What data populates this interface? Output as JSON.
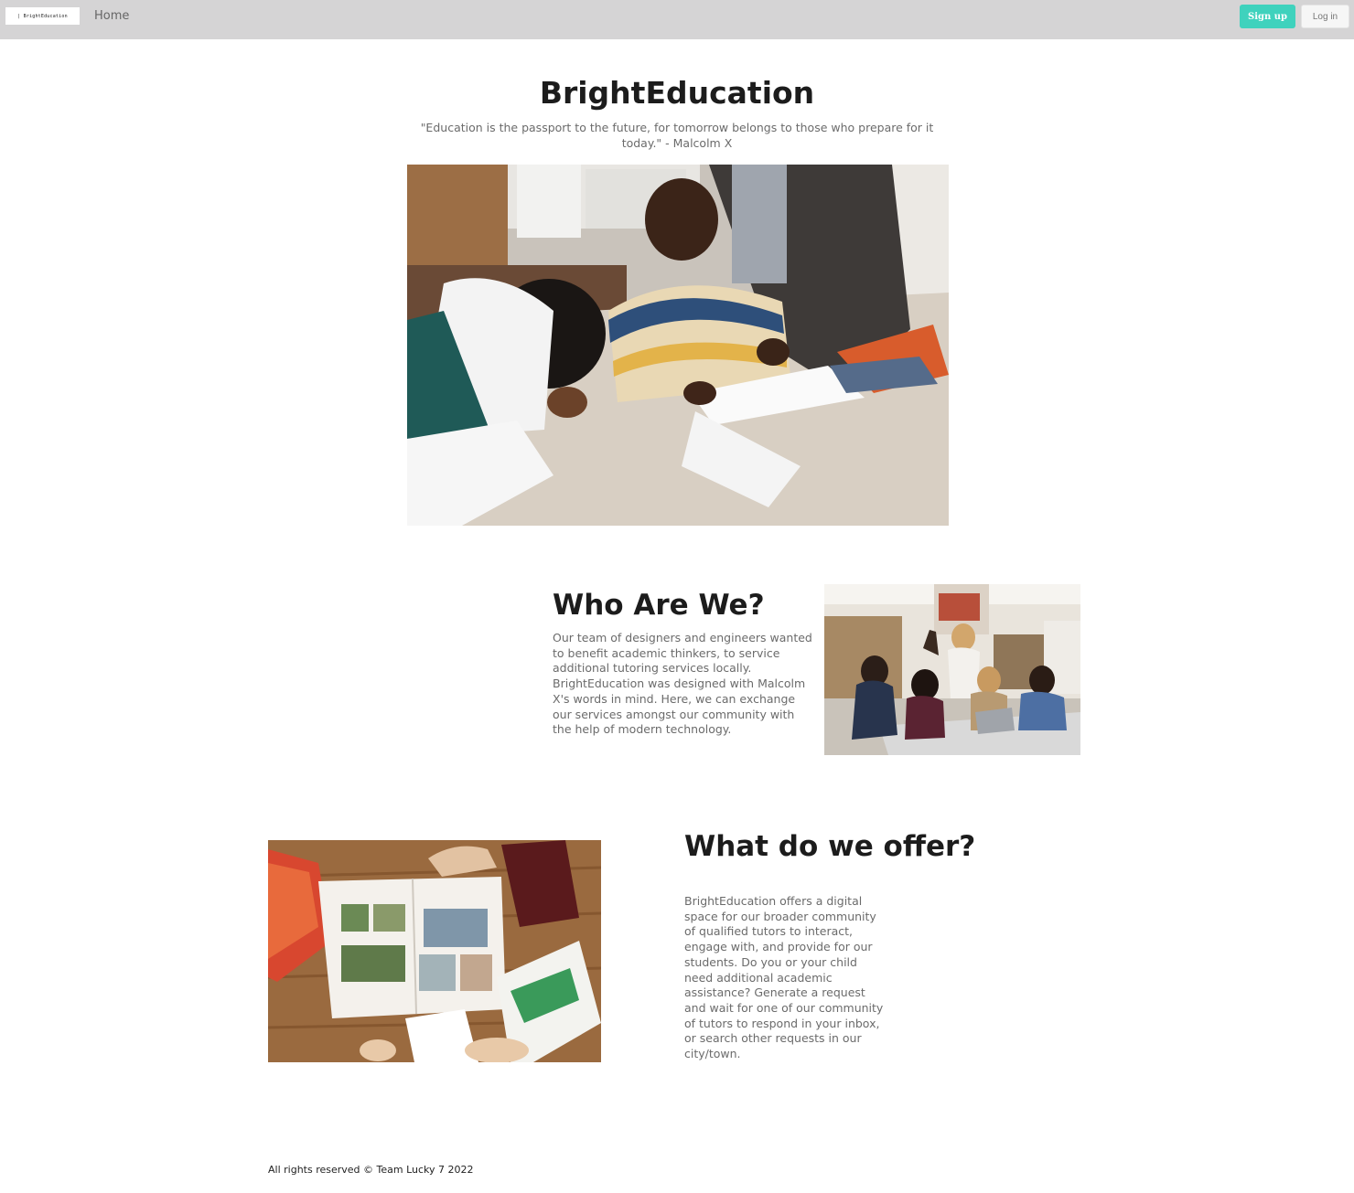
{
  "navbar": {
    "logo_text": "| BrightEducation",
    "home_label": "Home",
    "signup_label": "Sign up",
    "login_label": "Log in"
  },
  "hero": {
    "title": "BrightEducation",
    "quote": "\"Education is the passport to the future, for tomorrow belongs to those who prepare for it today.\" - Malcolm X"
  },
  "who": {
    "heading": "Who Are We?",
    "text": "Our team of designers and engineers wanted to benefit academic thinkers, to service additional tutoring services locally. BrightEducation was designed with Malcolm X's words in mind. Here, we can exchange our services amongst our community with the help of modern technology."
  },
  "offer": {
    "heading": "What do we offer?",
    "text": "BrightEducation offers a digital space for our broader community of qualified tutors to interact, engage with, and provide for our students. Do you or your child need additional academic assistance? Generate a request and wait for one of our community of tutors to respond in your inbox, or search other requests in our city/town."
  },
  "footer": {
    "text": "All rights reserved © Team Lucky 7 2022"
  },
  "colors": {
    "navbar_bg": "#d5d4d5",
    "accent": "#3fd2bd"
  }
}
